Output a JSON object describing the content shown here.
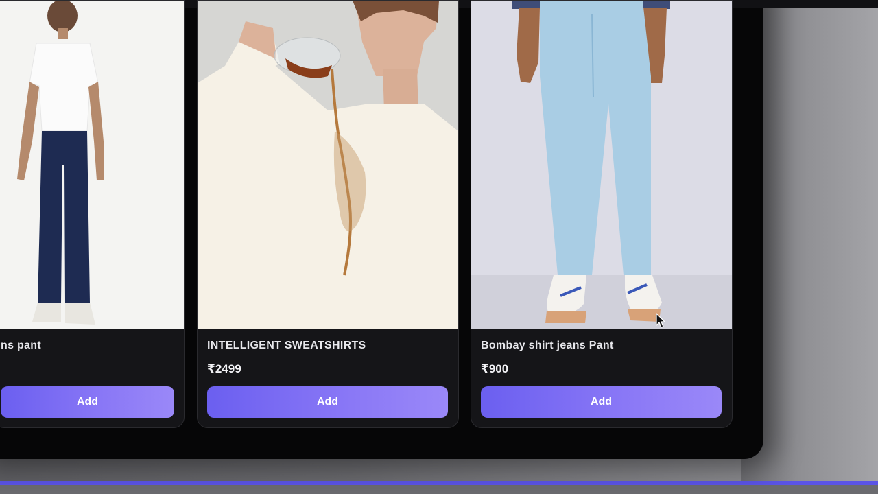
{
  "products": [
    {
      "title": "ns pant",
      "price": "",
      "add_label": "Add",
      "image": "model-white-tee-dark-jeans"
    },
    {
      "title": "INTELLIGENT SWEATSHIRTS",
      "price": "₹2499",
      "add_label": "Add",
      "image": "model-pouring-drink-on-cream-sweatshirt"
    },
    {
      "title": "Bombay shirt jeans Pant",
      "price": "₹900",
      "add_label": "Add",
      "image": "model-light-blue-jeans-white-sneakers"
    }
  ],
  "colors": {
    "accent": "#7b6cf3",
    "card_bg": "#151518",
    "frame_bg": "#060607",
    "bottom_bar": "#5b54e6"
  },
  "cursor": "arrow-pointer-icon"
}
